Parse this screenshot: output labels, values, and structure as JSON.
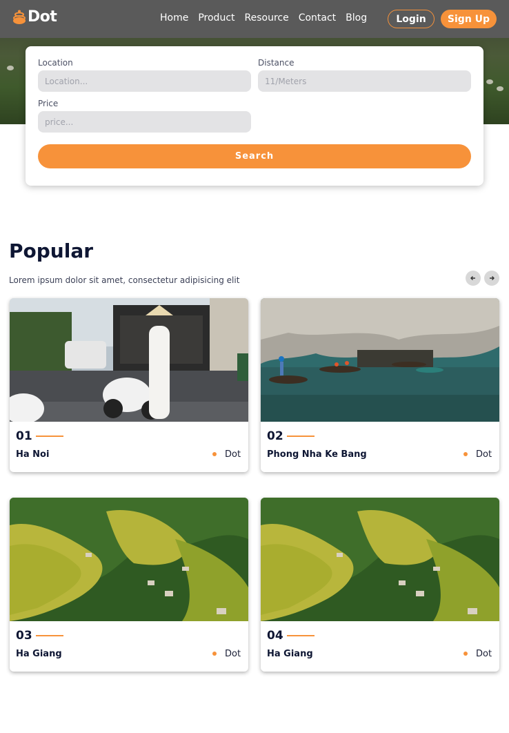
{
  "brand": {
    "name": "Dot",
    "accent": "#f7923a"
  },
  "nav": {
    "links": [
      "Home",
      "Product",
      "Resource",
      "Contact",
      "Blog"
    ],
    "login": "Login",
    "signup": "Sign Up"
  },
  "search": {
    "location_label": "Location",
    "location_placeholder": "Location...",
    "distance_label": "Distance",
    "distance_placeholder": "11/Meters",
    "price_label": "Price",
    "price_placeholder": "price...",
    "button": "Search"
  },
  "popular": {
    "title": "Popular",
    "subtitle": "Lorem ipsum dolor sit amet, consectetur adipisicing elit",
    "prev_icon": "arrow-left-icon",
    "next_icon": "arrow-right-icon",
    "cards": [
      {
        "num": "01",
        "name": "Ha Noi",
        "tag": "Dot"
      },
      {
        "num": "02",
        "name": "Phong Nha Ke Bang",
        "tag": "Dot"
      },
      {
        "num": "03",
        "name": "Ha Giang",
        "tag": "Dot"
      },
      {
        "num": "04",
        "name": "Ha Giang",
        "tag": "Dot"
      }
    ]
  }
}
